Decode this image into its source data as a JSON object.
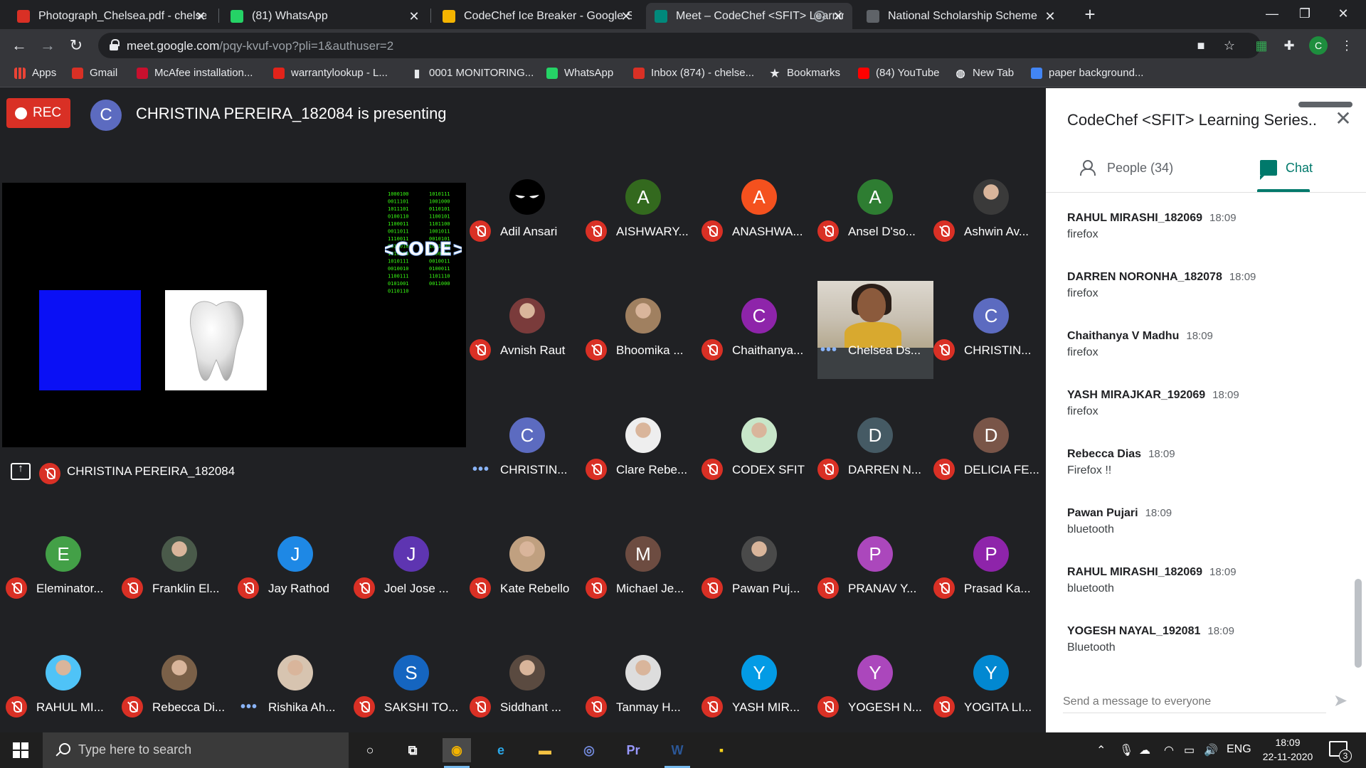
{
  "tabs": [
    {
      "label": "Photograph_Chelsea.pdf - chelsea",
      "icon": "gmail-icon",
      "color": "#d93025",
      "active": false
    },
    {
      "label": "(81) WhatsApp",
      "icon": "whatsapp-icon",
      "color": "#25d366",
      "active": false
    },
    {
      "label": "CodeChef Ice Breaker - Google Sheets",
      "icon": "sheets-icon",
      "color": "#f4b400",
      "active": false
    },
    {
      "label": "Meet – CodeChef <SFIT> Learning Series",
      "icon": "meet-icon",
      "color": "#00897b",
      "active": true
    },
    {
      "label": "National Scholarship Scheme",
      "icon": "globe-icon",
      "color": "#5f6368",
      "active": false
    }
  ],
  "omnibox": {
    "host": "meet.google.com",
    "path": "/pqy-kvuf-vop?pli=1&authuser=2"
  },
  "profile_letter": "C",
  "bookmarks": [
    {
      "label": "Apps",
      "icon": "apps-grid-icon",
      "color": "#4285f4"
    },
    {
      "label": "Gmail",
      "icon": "gmail-icon",
      "color": "#d93025"
    },
    {
      "label": "McAfee installation...",
      "icon": "mcafee-icon",
      "color": "#c8102e"
    },
    {
      "label": "warrantylookup - L...",
      "icon": "lenovo-icon",
      "color": "#e2231a"
    },
    {
      "label": "0001 MONITORING...",
      "icon": "doc-icon",
      "color": "#e8eaed"
    },
    {
      "label": "WhatsApp",
      "icon": "whatsapp-icon",
      "color": "#25d366"
    },
    {
      "label": "Inbox (874) - chelse...",
      "icon": "gmail-icon",
      "color": "#d93025"
    },
    {
      "label": "Bookmarks",
      "icon": "star-icon",
      "color": "#e8eaed"
    },
    {
      "label": "(84) YouTube",
      "icon": "youtube-icon",
      "color": "#ff0000"
    },
    {
      "label": "New Tab",
      "icon": "globe-icon",
      "color": "#e8eaed"
    },
    {
      "label": "paper background...",
      "icon": "google-icon",
      "color": "#4285f4"
    }
  ],
  "meet": {
    "rec_label": "REC",
    "presenter_initial": "C",
    "presenting_text": "CHRISTINA PEREIRA_182084 is presenting",
    "share_name": "CHRISTINA PEREIRA_182084",
    "code_logo_text": "<CODE>",
    "binary_lines": [
      "1000100",
      "0011101",
      "1011101",
      "0100110",
      "1100011",
      "0011011",
      "1110011",
      "0010010",
      "1010100",
      "1010111",
      "0010010",
      "1100111",
      "0101001",
      "0110110",
      "1010111",
      "1001000",
      "0110101",
      "1100101",
      "1101100",
      "1001011",
      "0010101",
      "1001000",
      "1100100",
      "0010011",
      "0100011",
      "1101110",
      "0011000"
    ]
  },
  "participants": [
    {
      "name": "Adil Ansari",
      "initial": "",
      "avatar": "mask-photo",
      "color": "#000000",
      "status": "muted"
    },
    {
      "name": "AISHWARY...",
      "initial": "A",
      "avatar": "letter",
      "color": "#33691e",
      "status": "muted"
    },
    {
      "name": "ANASHWA...",
      "initial": "A",
      "avatar": "letter",
      "color": "#f4511e",
      "status": "muted"
    },
    {
      "name": "Ansel D'so...",
      "initial": "A",
      "avatar": "letter",
      "color": "#2e7d32",
      "status": "muted"
    },
    {
      "name": "Ashwin Av...",
      "initial": "",
      "avatar": "photo",
      "color": "#3a3a3a",
      "status": "muted"
    },
    {
      "name": "Avnish Raut",
      "initial": "",
      "avatar": "photo",
      "color": "#7a3b3b",
      "status": "muted"
    },
    {
      "name": "Bhoomika ...",
      "initial": "",
      "avatar": "photo",
      "color": "#a08060",
      "status": "muted"
    },
    {
      "name": "Chaithanya...",
      "initial": "C",
      "avatar": "letter",
      "color": "#8e24aa",
      "status": "muted"
    },
    {
      "name": "Chelsea Ds...",
      "initial": "",
      "avatar": "video",
      "color": "#3c4043",
      "status": "speaking"
    },
    {
      "name": "CHRISTIN...",
      "initial": "C",
      "avatar": "letter",
      "color": "#5c6bc0",
      "status": "muted"
    },
    {
      "name": "CHRISTIN...",
      "initial": "C",
      "avatar": "letter",
      "color": "#5c6bc0",
      "status": "speaking"
    },
    {
      "name": "Clare Rebe...",
      "initial": "",
      "avatar": "photo",
      "color": "#eeeeee",
      "status": "muted"
    },
    {
      "name": "CODEX SFIT",
      "initial": "",
      "avatar": "photo",
      "color": "#c8e6c9",
      "status": "muted"
    },
    {
      "name": "DARREN N...",
      "initial": "D",
      "avatar": "letter",
      "color": "#455a64",
      "status": "muted"
    },
    {
      "name": "DELICIA FE...",
      "initial": "D",
      "avatar": "letter",
      "color": "#795548",
      "status": "muted"
    },
    {
      "name": "Eleminator...",
      "initial": "E",
      "avatar": "letter",
      "color": "#43a047",
      "status": "muted"
    },
    {
      "name": "Franklin El...",
      "initial": "",
      "avatar": "photo",
      "color": "#4a5a4a",
      "status": "muted"
    },
    {
      "name": "Jay Rathod",
      "initial": "J",
      "avatar": "letter",
      "color": "#1e88e5",
      "status": "muted"
    },
    {
      "name": "Joel Jose ...",
      "initial": "J",
      "avatar": "letter",
      "color": "#5e35b1",
      "status": "muted"
    },
    {
      "name": "Kate Rebello",
      "initial": "",
      "avatar": "photo",
      "color": "#c0a080",
      "status": "muted"
    },
    {
      "name": "Michael Je...",
      "initial": "M",
      "avatar": "letter",
      "color": "#6d4c41",
      "status": "muted"
    },
    {
      "name": "Pawan Puj...",
      "initial": "",
      "avatar": "photo",
      "color": "#4a4a4a",
      "status": "muted"
    },
    {
      "name": "PRANAV Y...",
      "initial": "P",
      "avatar": "letter",
      "color": "#ab47bc",
      "status": "muted"
    },
    {
      "name": "Prasad Ka...",
      "initial": "P",
      "avatar": "letter",
      "color": "#8e24aa",
      "status": "muted"
    },
    {
      "name": "RAHUL MI...",
      "initial": "",
      "avatar": "photo",
      "color": "#4fc3f7",
      "status": "muted"
    },
    {
      "name": "Rebecca Di...",
      "initial": "",
      "avatar": "photo",
      "color": "#7a6048",
      "status": "muted"
    },
    {
      "name": "Rishika Ah...",
      "initial": "",
      "avatar": "photo",
      "color": "#d7c4b0",
      "status": "speaking"
    },
    {
      "name": "SAKSHI TO...",
      "initial": "S",
      "avatar": "letter",
      "color": "#1565c0",
      "status": "muted"
    },
    {
      "name": "Siddhant ...",
      "initial": "",
      "avatar": "photo",
      "color": "#5a4a40",
      "status": "muted"
    },
    {
      "name": "Tanmay H...",
      "initial": "",
      "avatar": "photo",
      "color": "#dddddd",
      "status": "muted"
    },
    {
      "name": "YASH MIR...",
      "initial": "Y",
      "avatar": "letter",
      "color": "#039be5",
      "status": "muted"
    },
    {
      "name": "YOGESH N...",
      "initial": "Y",
      "avatar": "letter",
      "color": "#ab47bc",
      "status": "muted"
    },
    {
      "name": "YOGITA LI...",
      "initial": "Y",
      "avatar": "letter",
      "color": "#0288d1",
      "status": "muted"
    }
  ],
  "panel": {
    "title": "CodeChef <SFIT> Learning Series...",
    "people_tab": "People (34)",
    "chat_tab": "Chat",
    "input_placeholder": "Send a message to everyone",
    "accent": "#00796b"
  },
  "messages": [
    {
      "sender": "RAHUL MIRASHI_182069",
      "time": "18:09",
      "text": "firefox"
    },
    {
      "sender": "DARREN NORONHA_182078",
      "time": "18:09",
      "text": "firefox"
    },
    {
      "sender": "Chaithanya V Madhu",
      "time": "18:09",
      "text": "firefox"
    },
    {
      "sender": "YASH MIRAJKAR_192069",
      "time": "18:09",
      "text": "firefox"
    },
    {
      "sender": "Rebecca Dias",
      "time": "18:09",
      "text": "Firefox !!"
    },
    {
      "sender": "Pawan Pujari",
      "time": "18:09",
      "text": "bluetooth"
    },
    {
      "sender": "RAHUL MIRASHI_182069",
      "time": "18:09",
      "text": "bluetooth"
    },
    {
      "sender": "YOGESH NAYAL_192081",
      "time": "18:09",
      "text": "Bluetooth"
    }
  ],
  "taskbar": {
    "search_placeholder": "Type here to search",
    "apps": [
      {
        "name": "cortana-icon",
        "glyph": "○",
        "color": "#ffffff",
        "state": "idle"
      },
      {
        "name": "task-view-icon",
        "glyph": "⧉",
        "color": "#ffffff",
        "state": "idle"
      },
      {
        "name": "chrome-icon",
        "glyph": "◉",
        "color": "#f4b400",
        "state": "active"
      },
      {
        "name": "edge-icon",
        "glyph": "e",
        "color": "#2aa7e8",
        "state": "idle"
      },
      {
        "name": "file-explorer-icon",
        "glyph": "▬",
        "color": "#f5c242",
        "state": "idle"
      },
      {
        "name": "discord-icon",
        "glyph": "◎",
        "color": "#7289da",
        "state": "idle"
      },
      {
        "name": "premiere-icon",
        "glyph": "Pr",
        "color": "#9999ff",
        "state": "idle"
      },
      {
        "name": "word-icon",
        "glyph": "W",
        "color": "#2b5797",
        "state": "running"
      },
      {
        "name": "sticky-notes-icon",
        "glyph": "▪",
        "color": "#f7d21c",
        "state": "idle"
      }
    ],
    "language": "ENG",
    "time": "18:09",
    "date": "22-11-2020",
    "notification_count": "3"
  }
}
